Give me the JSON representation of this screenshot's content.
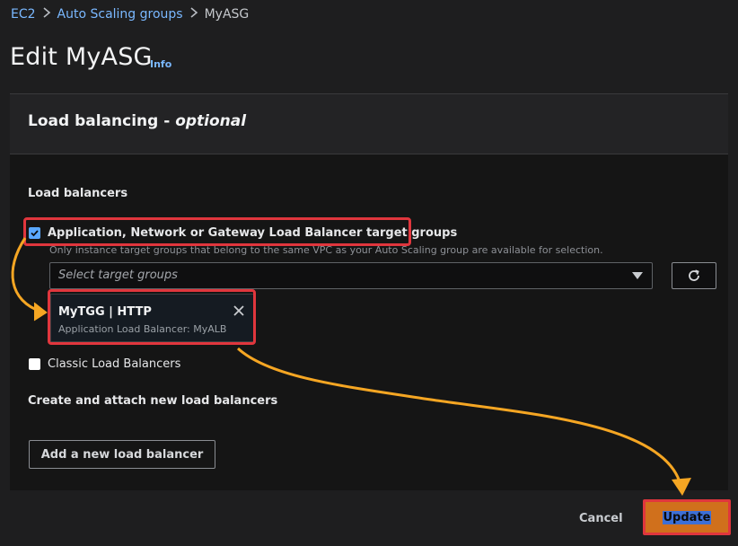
{
  "breadcrumb": {
    "items": [
      "EC2",
      "Auto Scaling groups",
      "MyASG"
    ]
  },
  "page": {
    "title": "Edit MyASG",
    "info_link": "Info"
  },
  "section": {
    "title_main": "Load balancing - ",
    "title_optional": "optional",
    "load_balancers_label": "Load balancers",
    "target_groups_option": {
      "label": "Application, Network or Gateway Load Balancer target groups",
      "checked": true,
      "hint": "Only instance target groups that belong to the same VPC as your Auto Scaling group are available for selection."
    },
    "select_placeholder": "Select target groups",
    "selected_group": {
      "name": "MyTGG | HTTP",
      "detail": "Application Load Balancer: MyALB"
    },
    "classic_option": {
      "label": "Classic Load Balancers",
      "checked": false
    },
    "create_heading": "Create and attach new load balancers",
    "add_button": "Add a new load balancer"
  },
  "footer": {
    "cancel": "Cancel",
    "update": "Update"
  },
  "colors": {
    "accent": "#7ab8ff",
    "primary_button": "#d0701c",
    "highlight_box": "#e0363d",
    "annotation_arrow": "#f5a623"
  },
  "icons": [
    "chevron-right-icon",
    "check-icon",
    "caret-down-icon",
    "refresh-icon",
    "close-icon"
  ]
}
